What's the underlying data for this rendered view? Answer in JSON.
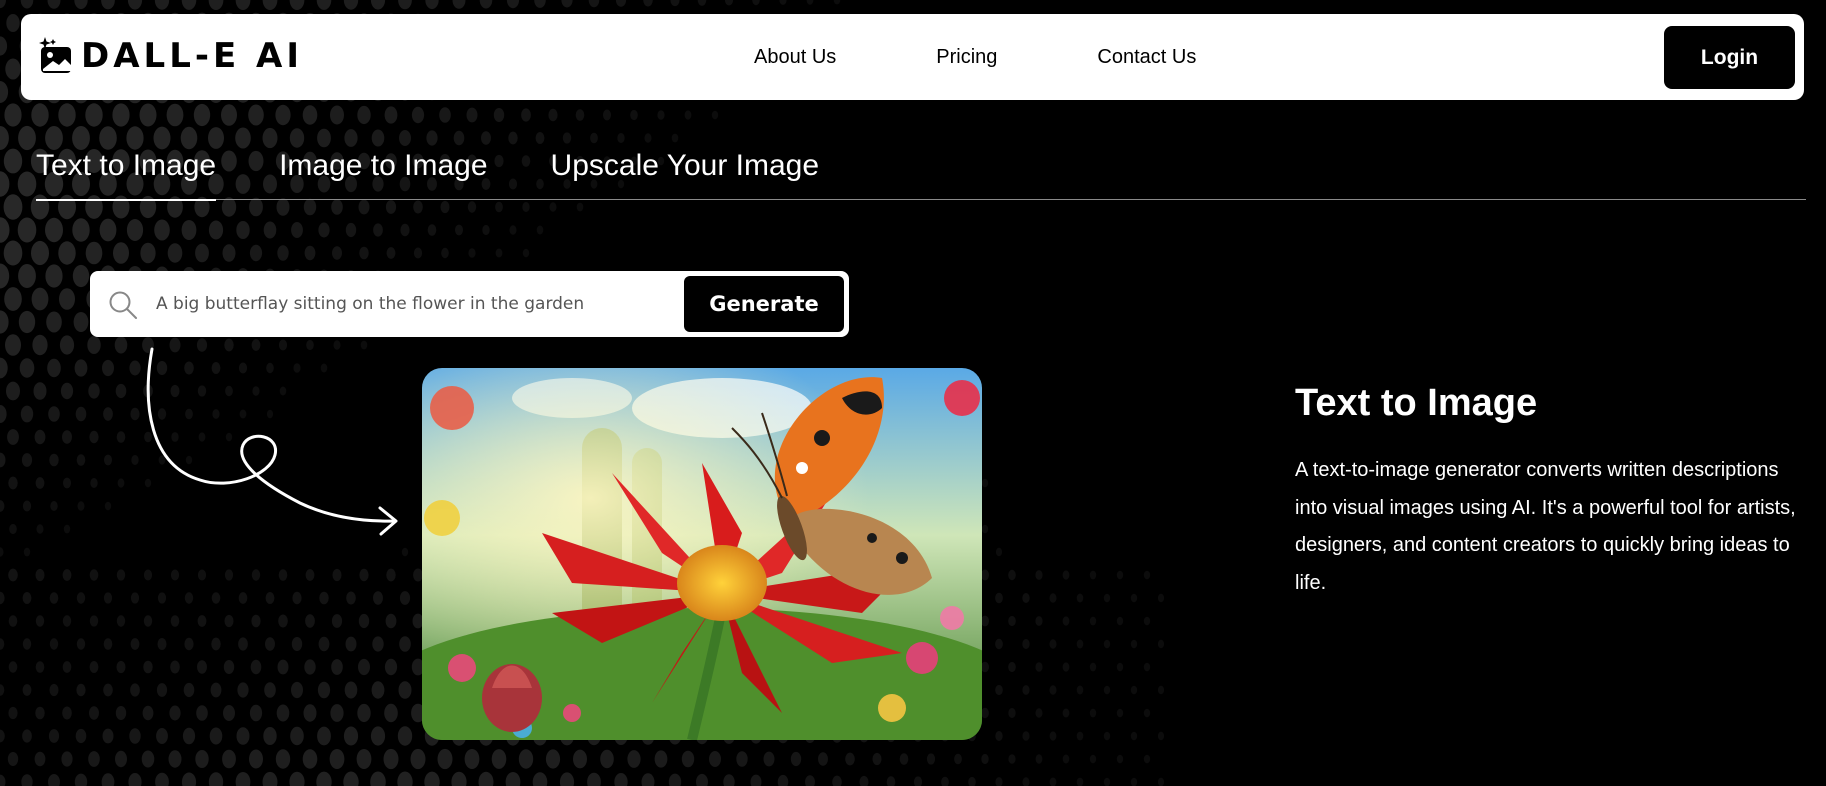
{
  "header": {
    "logo_text": "DALL-E AI",
    "logo_icon": "image-sparkle-icon",
    "nav": [
      {
        "label": "About Us"
      },
      {
        "label": "Pricing"
      },
      {
        "label": "Contact Us"
      }
    ],
    "login_label": "Login"
  },
  "tabs": [
    {
      "label": "Text to Image",
      "active": true
    },
    {
      "label": "Image to Image",
      "active": false
    },
    {
      "label": "Upscale Your Image",
      "active": false
    }
  ],
  "search": {
    "value": "A big butterflay sitting on the flower in the garden",
    "icon": "search-icon",
    "button_label": "Generate"
  },
  "result": {
    "image": "butterfly-on-red-flower-image"
  },
  "description": {
    "title": "Text to Image",
    "text": "A text-to-image generator converts written descriptions into visual images using AI. It's a powerful tool for artists, designers, and content creators to quickly bring ideas to life."
  },
  "colors": {
    "background": "#000000",
    "surface": "#ffffff",
    "button": "#000000",
    "dots": "#3a3a3a"
  }
}
